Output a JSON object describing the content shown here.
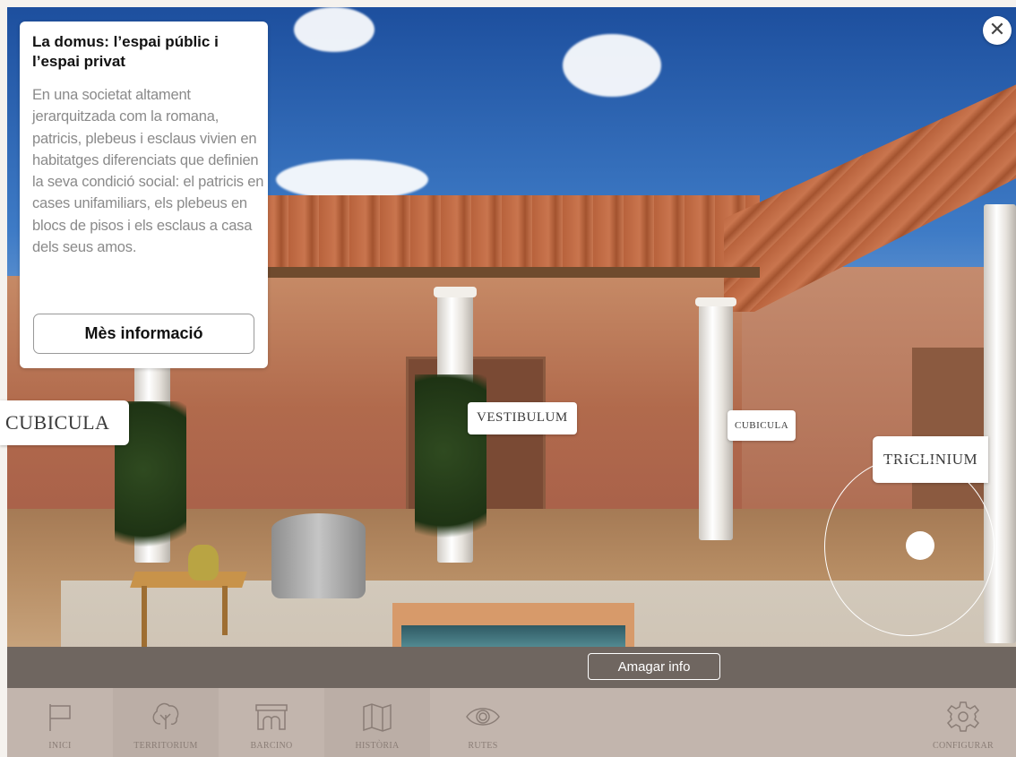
{
  "info_card": {
    "title": "La domus: l’espai públic i l’espai privat",
    "body": "En una societat altament jerarquitzada com la romana, patricis, plebeus i esclaus vivien en habitatges diferenciats que definien la seva condició social: el patricis en cases unifamiliars, els plebeus en blocs de pisos i els esclaus a casa dels seus amos.",
    "more_button": "Mès informació"
  },
  "close_icon": "close-icon",
  "scene_labels": {
    "cubicula_left": "CUBICULA",
    "vestibulum": "VESTIBULUM",
    "cubicula_right": "CUBICULA",
    "triclinium": "TRICLINIUM"
  },
  "info_bar": {
    "hide_button": "Amagar info"
  },
  "nav": {
    "items": [
      {
        "label": "INICI",
        "icon": "flag-icon"
      },
      {
        "label": "TERRITORIUM",
        "icon": "tree-icon"
      },
      {
        "label": "BARCINO",
        "icon": "aqueduct-icon"
      },
      {
        "label": "HISTÒRIA",
        "icon": "map-icon"
      },
      {
        "label": "RUTES",
        "icon": "eye-icon"
      },
      {
        "label": "CONFIGURAR",
        "icon": "gear-icon"
      }
    ]
  },
  "colors": {
    "info_bar": "#6f6660",
    "nav_bar": "#c2b5ad",
    "nav_text": "#8a7d76"
  }
}
